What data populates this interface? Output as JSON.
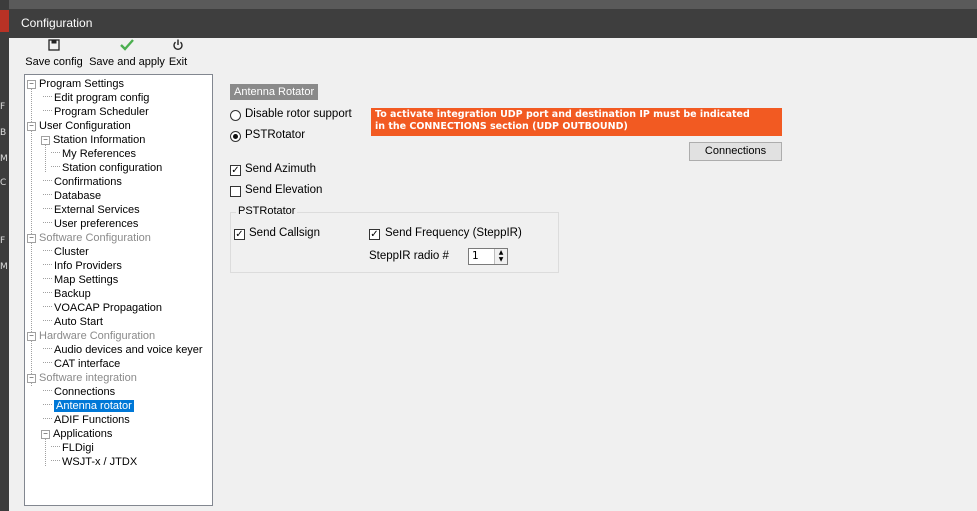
{
  "window": {
    "title": "Configuration"
  },
  "toolbar": {
    "save_config": "Save config",
    "save_and_apply": "Save and apply",
    "exit": "Exit"
  },
  "left_strip": {
    "marks": [
      "F",
      "B",
      "M",
      "C",
      "F",
      "M"
    ]
  },
  "tree": {
    "program_settings": "Program Settings",
    "edit_program_config": "Edit program config",
    "program_scheduler": "Program Scheduler",
    "user_configuration": "User Configuration",
    "station_information": "Station Information",
    "my_references": "My References",
    "station_configuration": "Station configuration",
    "confirmations": "Confirmations",
    "database": "Database",
    "external_services": "External Services",
    "user_preferences": "User preferences",
    "software_configuration": "Software Configuration",
    "cluster": "Cluster",
    "info_providers": "Info Providers",
    "map_settings": "Map Settings",
    "backup": "Backup",
    "voacap_propagation": "VOACAP Propagation",
    "auto_start": "Auto Start",
    "hardware_configuration": "Hardware Configuration",
    "audio_devices": "Audio devices and voice keyer",
    "cat_interface": "CAT interface",
    "software_integration": "Software integration",
    "connections": "Connections",
    "antenna_rotator": "Antenna rotator",
    "adif_functions": "ADIF Functions",
    "applications": "Applications",
    "fldigi": "FLDigi",
    "wsjtx": "WSJT-x / JTDX"
  },
  "panel": {
    "section_title": "Antenna Rotator",
    "disable_rotor_support": "Disable rotor support",
    "pstrotator_radio": "PSTRotator",
    "selected_mode": "PSTRotator",
    "warning_line1": "To activate integration UDP port and destination IP must be indicated",
    "warning_line2": "in the CONNECTIONS section (UDP OUTBOUND)",
    "connections_button": "Connections",
    "send_azimuth": "Send Azimuth",
    "send_azimuth_checked": true,
    "send_elevation": "Send Elevation",
    "send_elevation_checked": false,
    "group_title": "PSTRotator",
    "send_callsign": "Send Callsign",
    "send_callsign_checked": true,
    "send_frequency": "Send Frequency (SteppIR)",
    "send_frequency_checked": true,
    "steppir_radio_label": "SteppIR radio #",
    "steppir_radio_value": "1"
  },
  "colors": {
    "title_bar": "#3e3e3e",
    "warning_background": "#f25a22",
    "selection": "#0078d7",
    "save_apply_icon": "#4caf50"
  },
  "icons": {
    "save_config": "floppy-disk-icon",
    "save_and_apply": "checkmark-icon",
    "exit": "power-icon"
  }
}
